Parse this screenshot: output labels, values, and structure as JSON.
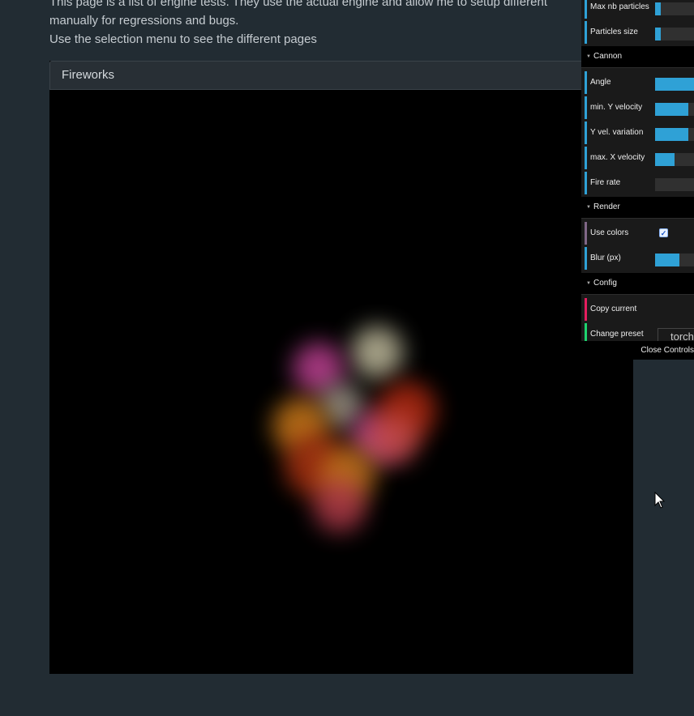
{
  "intro": {
    "line1": "This page is a list of engine tests. They use the actual engine and allow me to setup different",
    "line2": "manually for regressions and bugs.",
    "line3": "Use the selection menu to see the different pages"
  },
  "panel": {
    "title": "Fireworks"
  },
  "controls": {
    "max_particles": {
      "label": "Max nb particles",
      "fill": 0.14
    },
    "particles_size": {
      "label": "Particles size",
      "fill": 0.14
    },
    "cannon_folder": "Cannon",
    "angle": {
      "label": "Angle",
      "fill": 1.0
    },
    "min_y_velocity": {
      "label": "min. Y velocity",
      "fill": 0.8
    },
    "y_vel_variation": {
      "label": "Y vel. variation",
      "fill": 0.8
    },
    "max_x_velocity": {
      "label": "max. X velocity",
      "fill": 0.48
    },
    "fire_rate": {
      "label": "Fire rate",
      "fill": 0.0
    },
    "render_folder": "Render",
    "use_colors": {
      "label": "Use colors",
      "checked": true
    },
    "blur": {
      "label": "Blur (px)",
      "fill": 0.58
    },
    "config_folder": "Config",
    "copy_current": {
      "label": "Copy current"
    },
    "change_preset": {
      "label": "Change preset",
      "value": "torch"
    },
    "close_label": "Close Controls"
  },
  "colors": {
    "accent": "#2fa1d6",
    "background": "#222c33",
    "canvas": "#000000"
  }
}
